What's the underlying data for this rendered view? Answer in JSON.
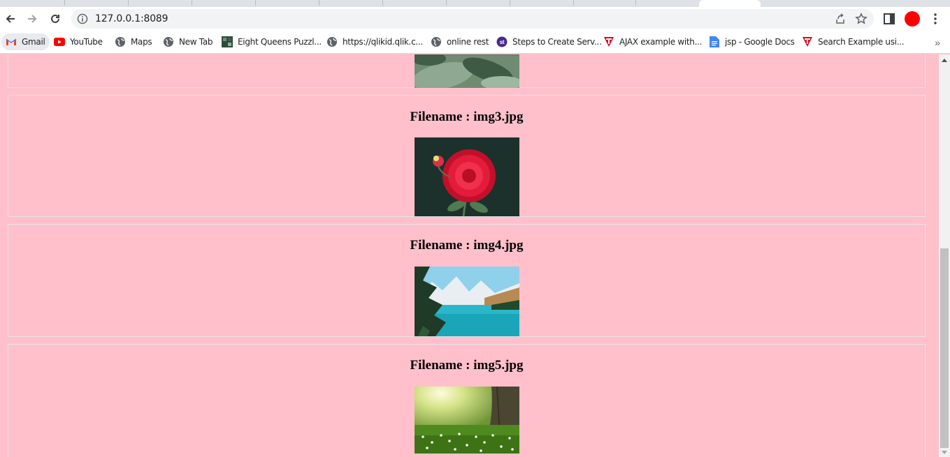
{
  "browser": {
    "url": "127.0.0.1:8089",
    "profile_color": "#ff0000"
  },
  "bookmarks": [
    {
      "label": "Gmail",
      "icon": "gmail-icon"
    },
    {
      "label": "YouTube",
      "icon": "youtube-icon"
    },
    {
      "label": "Maps",
      "icon": "globe-icon"
    },
    {
      "label": "New Tab",
      "icon": "globe-icon"
    },
    {
      "label": "Eight Queens Puzzl...",
      "icon": "image-icon"
    },
    {
      "label": "https://qlikid.qlik.c...",
      "icon": "globe-icon"
    },
    {
      "label": "online rest",
      "icon": "globe-icon"
    },
    {
      "label": "Steps to Create Serv...",
      "icon": "st-icon"
    },
    {
      "label": "AJAX example with...",
      "icon": "t-logo-icon"
    },
    {
      "label": "jsp - Google Docs",
      "icon": "docs-icon"
    },
    {
      "label": "Search Example usi...",
      "icon": "t-logo-icon"
    }
  ],
  "page": {
    "background": "#ffc0cb",
    "cards": [
      {
        "filename_label": "",
        "image": "plant-leaves"
      },
      {
        "filename_label": "Filename : img3.jpg",
        "image": "red-dahlia"
      },
      {
        "filename_label": "Filename : img4.jpg",
        "image": "mountain-lake"
      },
      {
        "filename_label": "Filename : img5.jpg",
        "image": "sunlit-meadow"
      }
    ]
  }
}
